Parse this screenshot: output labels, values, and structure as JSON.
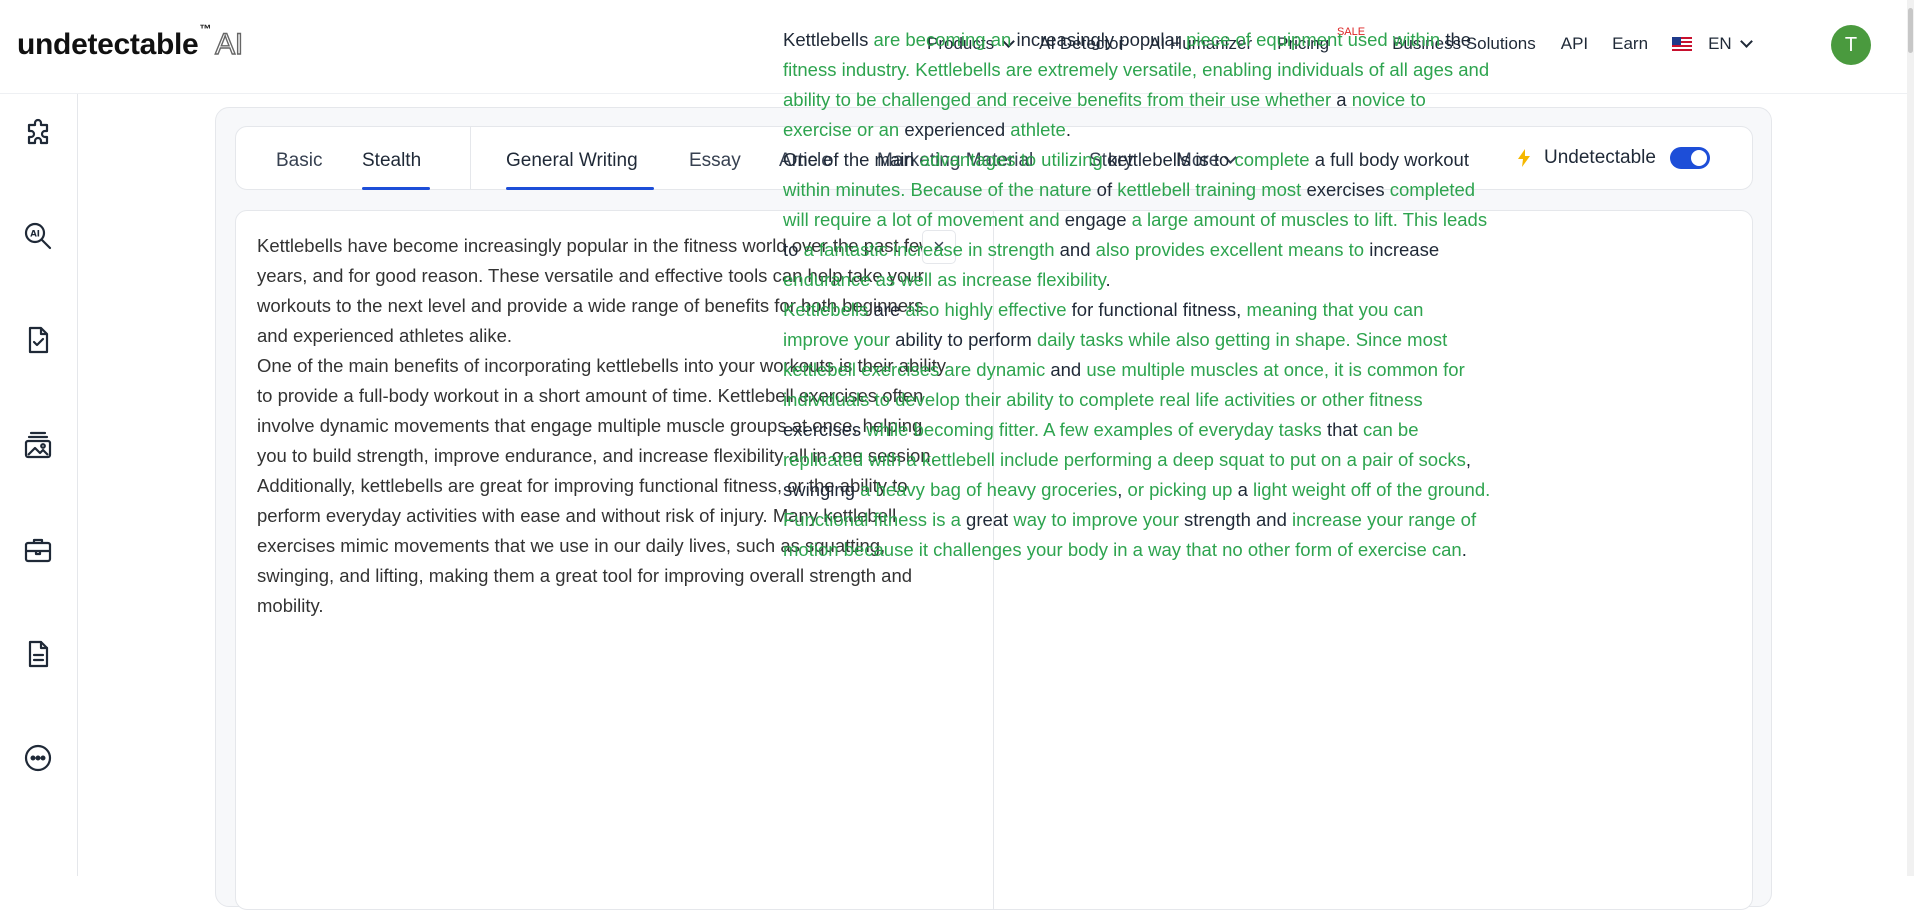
{
  "header": {
    "logo_text": "undetectable",
    "logo_tm": "™",
    "logo_ai": "AI",
    "nav": [
      {
        "label": "Products",
        "dropdown": true
      },
      {
        "label": "AI Detector"
      },
      {
        "label": "AI Humanizer"
      },
      {
        "label": "Pricing",
        "badge": "SALE"
      },
      {
        "label": "Business Solutions"
      },
      {
        "label": "API"
      },
      {
        "label": "Earn"
      }
    ],
    "language": "EN",
    "avatar_initial": "T"
  },
  "sidebar": {
    "icons": [
      "puzzle-icon",
      "ai-search-icon",
      "document-check-icon",
      "image-stack-icon",
      "briefcase-icon",
      "document-icon",
      "more-icon"
    ]
  },
  "mode_tabs": [
    "Basic",
    "Stealth"
  ],
  "active_mode": "Stealth",
  "purpose_tabs": [
    "General Writing",
    "Essay",
    "Article",
    "Marketing Material",
    "Story",
    "More"
  ],
  "active_purpose": "General Writing",
  "undetectable_label": "Undetectable",
  "undetectable_on": true,
  "input": {
    "paragraphs": [
      "Kettlebells have become increasingly popular in the fitness world over the past few years, and for good reason. These versatile and effective tools can help take your workouts to the next level and provide a wide range of benefits for both beginners and experienced athletes alike.",
      "One of the main benefits of incorporating kettlebells into your workouts is their ability to provide a full-body workout in a short amount of time. Kettlebell exercises often involve dynamic movements that engage multiple muscle groups at once, helping you to build strength, improve endurance, and increase flexibility all in one session.",
      "Additionally, kettlebells are great for improving functional fitness, or the ability to perform everyday activities with ease and without risk of injury. Many kettlebell exercises mimic movements that we use in our daily lives, such as squatting, swinging, and lifting, making them a great tool for improving overall strength and mobility."
    ],
    "clear_symbol": "×"
  },
  "output": {
    "highlight_color": "#2ea44f",
    "paragraphs": [
      [
        [
          "Kettlebells ",
          false
        ],
        [
          "are becoming an ",
          true
        ],
        [
          "increasingly popular ",
          false
        ],
        [
          "piece of equipment used within ",
          true
        ],
        [
          "the ",
          false
        ],
        [
          "fitness industry. Kettlebells are extremely versatile, enabling individuals of all ages and ability to be challenged and receive benefits from their use whether ",
          true
        ],
        [
          "a ",
          false
        ],
        [
          "novice to exercise or an ",
          true
        ],
        [
          "experienced ",
          false
        ],
        [
          "athlete",
          true
        ],
        [
          ".",
          false
        ]
      ],
      [
        [
          "One of the main ",
          false
        ],
        [
          "advantages to utilizing ",
          true
        ],
        [
          "kettlebells is to ",
          false
        ],
        [
          "complete ",
          true
        ],
        [
          "a full body workout ",
          false
        ],
        [
          "within minutes. Because of the nature ",
          true
        ],
        [
          "of ",
          false
        ],
        [
          "kettlebell training most ",
          true
        ],
        [
          "exercises ",
          false
        ],
        [
          "completed will require a lot of movement and ",
          true
        ],
        [
          "engage ",
          false
        ],
        [
          "a large amount of muscles to lift. This leads ",
          true
        ],
        [
          "to ",
          false
        ],
        [
          "a fantastic increase in strength ",
          true
        ],
        [
          "and ",
          false
        ],
        [
          "also provides excellent means to ",
          true
        ],
        [
          "increase ",
          false
        ],
        [
          "endurance as well as increase flexibility",
          true
        ],
        [
          ".",
          false
        ]
      ],
      [
        [
          "Kettlebells ",
          true
        ],
        [
          "are ",
          false
        ],
        [
          "also highly effective ",
          true
        ],
        [
          "for functional fitness, ",
          false
        ],
        [
          "meaning that you can improve your ",
          true
        ],
        [
          "ability to perform ",
          false
        ],
        [
          "daily tasks while also getting in shape. Since most kettlebell exercises are dynamic ",
          true
        ],
        [
          "and ",
          false
        ],
        [
          "use multiple muscles at once, it is common for individuals to develop their ability to complete real life activities or other fitness ",
          true
        ],
        [
          "exercises ",
          false
        ],
        [
          "while becoming fitter. A few examples of everyday tasks ",
          true
        ],
        [
          "that ",
          false
        ],
        [
          "can be replicated with a kettlebell include performing a deep squat to put on a pair of socks",
          true
        ],
        [
          ", swinging ",
          false
        ],
        [
          "a heavy bag of heavy groceries",
          true
        ],
        [
          ", ",
          false
        ],
        [
          "or picking up ",
          true
        ],
        [
          "a ",
          false
        ],
        [
          "light weight off of the ground. Functional fitness is a ",
          true
        ],
        [
          "great ",
          false
        ],
        [
          "way to improve your ",
          true
        ],
        [
          "strength and ",
          false
        ],
        [
          "increase your range of motion because it challenges your body in a way that no other form of exercise can",
          true
        ],
        [
          ".",
          false
        ]
      ]
    ]
  }
}
